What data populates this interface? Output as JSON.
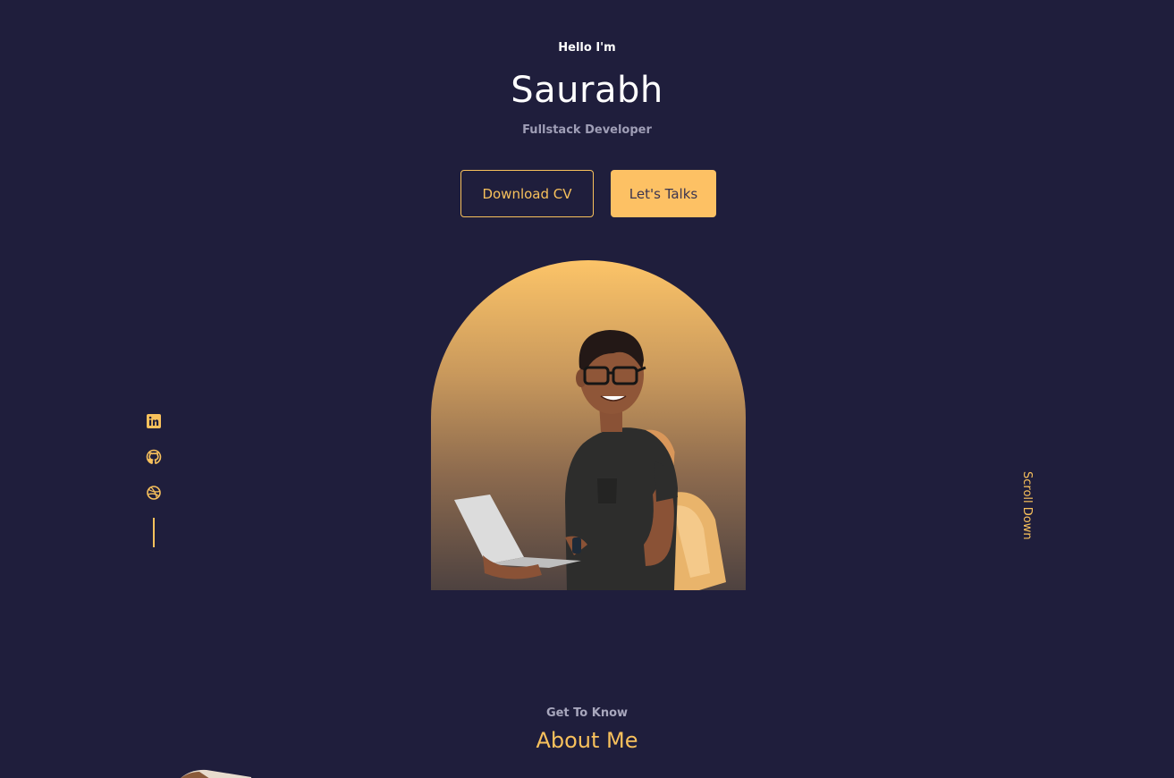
{
  "hero": {
    "greeting": "Hello I'm",
    "name": "Saurabh",
    "role": "Fullstack Developer",
    "download_cv_label": "Download CV",
    "lets_talk_label": "Let's Talks"
  },
  "socials": {
    "icons": [
      "linkedin-icon",
      "github-icon",
      "dribbble-icon"
    ]
  },
  "scroll_down_label": "Scroll Down",
  "about": {
    "subtitle": "Get To Know",
    "title": "About Me"
  },
  "colors": {
    "background": "#1f1e3c",
    "accent": "#f8c15c",
    "text": "#ffffff",
    "muted": "#9f9eb6"
  }
}
